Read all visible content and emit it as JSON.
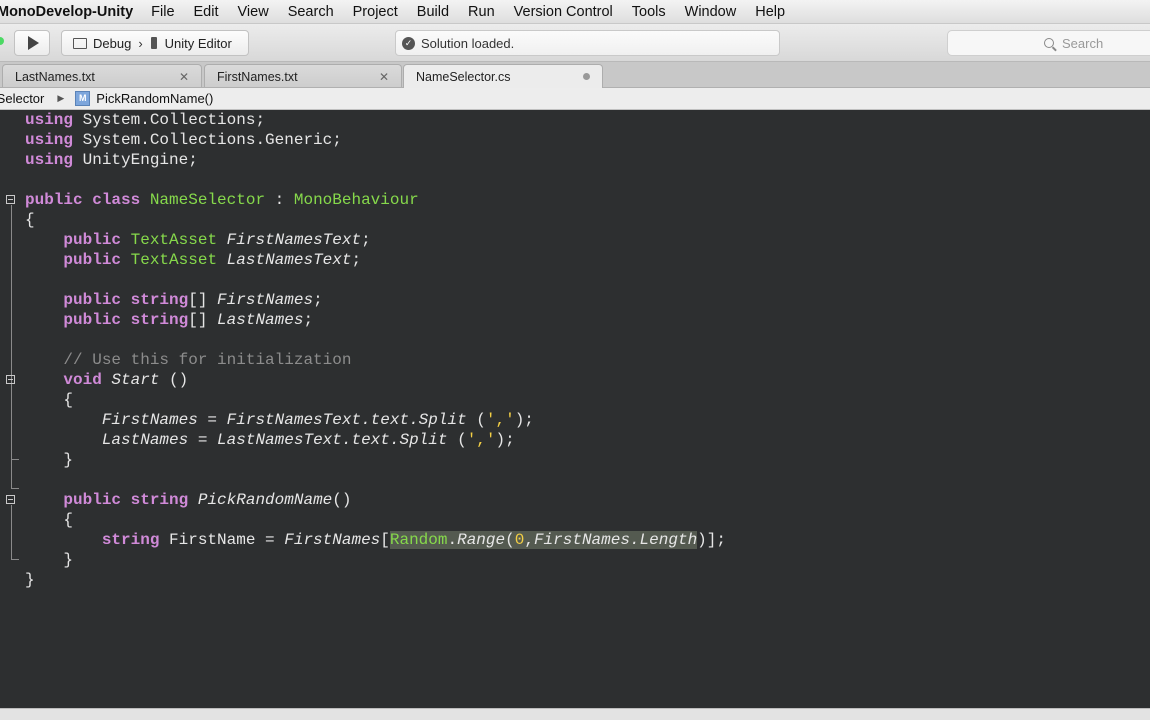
{
  "menubar": {
    "app_name": "MonoDevelop-Unity",
    "items": [
      "File",
      "Edit",
      "View",
      "Search",
      "Project",
      "Build",
      "Run",
      "Version Control",
      "Tools",
      "Window",
      "Help"
    ]
  },
  "toolbar": {
    "configuration": "Debug",
    "target": "Unity Editor",
    "status": "Solution loaded.",
    "search_placeholder": "Search"
  },
  "tabs": [
    {
      "label": "LastNames.txt",
      "active": false
    },
    {
      "label": "FirstNames.txt",
      "active": false
    },
    {
      "label": "NameSelector.cs",
      "active": true
    }
  ],
  "breadcrumb": {
    "class": "NameSelector",
    "method": "PickRandomName()",
    "method_icon_letter": "M"
  },
  "colors": {
    "editor_background": "#2d2f30",
    "keyword": "#d08ad8",
    "type": "#86d94b",
    "comment": "#8c8c8c",
    "literal": "#f3cf45",
    "selection": "#545a50"
  },
  "code_lines": [
    [
      [
        "k",
        "using"
      ],
      [
        "p",
        " System.Collections;"
      ]
    ],
    [
      [
        "k",
        "using"
      ],
      [
        "p",
        " System.Collections.Generic;"
      ]
    ],
    [
      [
        "k",
        "using"
      ],
      [
        "p",
        " UnityEngine;"
      ]
    ],
    [],
    [
      [
        "k",
        "public class"
      ],
      [
        "p",
        " "
      ],
      [
        "t",
        "NameSelector"
      ],
      [
        "p",
        " : "
      ],
      [
        "t",
        "MonoBehaviour"
      ]
    ],
    [
      [
        "p",
        "{"
      ]
    ],
    [
      [
        "p",
        "    "
      ],
      [
        "k",
        "public"
      ],
      [
        "p",
        " "
      ],
      [
        "t",
        "TextAsset"
      ],
      [
        "p",
        " "
      ],
      [
        "i",
        "FirstNamesText"
      ],
      [
        "p",
        ";"
      ]
    ],
    [
      [
        "p",
        "    "
      ],
      [
        "k",
        "public"
      ],
      [
        "p",
        " "
      ],
      [
        "t",
        "TextAsset"
      ],
      [
        "p",
        " "
      ],
      [
        "i",
        "LastNamesText"
      ],
      [
        "p",
        ";"
      ]
    ],
    [],
    [
      [
        "p",
        "    "
      ],
      [
        "k",
        "public string"
      ],
      [
        "p",
        "[] "
      ],
      [
        "i",
        "FirstNames"
      ],
      [
        "p",
        ";"
      ]
    ],
    [
      [
        "p",
        "    "
      ],
      [
        "k",
        "public string"
      ],
      [
        "p",
        "[] "
      ],
      [
        "i",
        "LastNames"
      ],
      [
        "p",
        ";"
      ]
    ],
    [],
    [
      [
        "p",
        "    "
      ],
      [
        "c",
        "// Use this for initialization"
      ]
    ],
    [
      [
        "p",
        "    "
      ],
      [
        "k",
        "void"
      ],
      [
        "p",
        " "
      ],
      [
        "i",
        "Start"
      ],
      [
        "p",
        " ()"
      ]
    ],
    [
      [
        "p",
        "    {"
      ]
    ],
    [
      [
        "p",
        "        "
      ],
      [
        "i",
        "FirstNames"
      ],
      [
        "p",
        " = "
      ],
      [
        "i",
        "FirstNamesText.text.Split"
      ],
      [
        "p",
        " ("
      ],
      [
        "s",
        "','"
      ],
      [
        "p",
        ");"
      ]
    ],
    [
      [
        "p",
        "        "
      ],
      [
        "i",
        "LastNames"
      ],
      [
        "p",
        " = "
      ],
      [
        "i",
        "LastNamesText.text.Split"
      ],
      [
        "p",
        " ("
      ],
      [
        "s",
        "','"
      ],
      [
        "p",
        ");"
      ]
    ],
    [
      [
        "p",
        "    }"
      ]
    ],
    [],
    [
      [
        "p",
        "    "
      ],
      [
        "k",
        "public string"
      ],
      [
        "p",
        " "
      ],
      [
        "i",
        "PickRandomName"
      ],
      [
        "p",
        "()"
      ]
    ],
    [
      [
        "p",
        "    {"
      ]
    ],
    [
      [
        "p",
        "        "
      ],
      [
        "k",
        "string"
      ],
      [
        "p",
        " FirstName = "
      ],
      [
        "i",
        "FirstNames"
      ],
      [
        "p",
        "["
      ],
      [
        "th",
        "Random"
      ],
      [
        "ph",
        "."
      ],
      [
        "ih",
        "Range"
      ],
      [
        "ph",
        "("
      ],
      [
        "sh",
        "0"
      ],
      [
        "ph",
        ","
      ],
      [
        "ih",
        "FirstNames.Length"
      ],
      [
        "p",
        ")];"
      ]
    ],
    [
      [
        "p",
        "    }"
      ]
    ],
    [
      [
        "p",
        "}"
      ]
    ]
  ]
}
